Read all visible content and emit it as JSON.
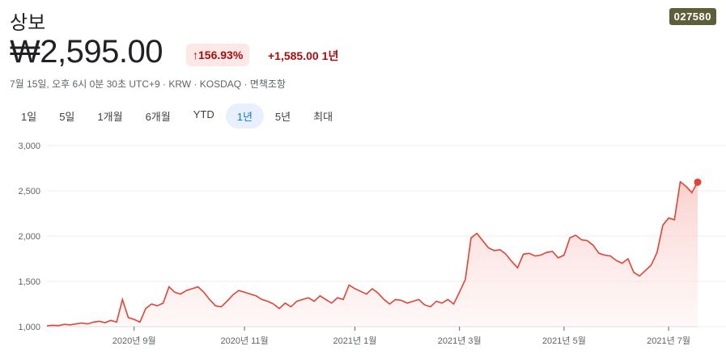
{
  "header": {
    "title": "상보",
    "ticker": "027580",
    "price": "₩2,595.00",
    "pct_change": "↑156.93%",
    "abs_change": "+1,585.00",
    "change_period": "1년",
    "meta": "7월 15일, 오후 6시 0분 30초 UTC+9 · KRW · KOSDAQ · 면책조항"
  },
  "ranges": [
    "1일",
    "5일",
    "1개월",
    "6개월",
    "YTD",
    "1년",
    "5년",
    "최대"
  ],
  "active_range": "1년",
  "colors": {
    "line": "#e34234",
    "fill_top": "#f8c9c4",
    "accent_bg": "#e8f0fe",
    "accent": "#1a73e8"
  },
  "chart_data": {
    "type": "area",
    "ylim": [
      1000,
      3000
    ],
    "yticks": [
      1000,
      1500,
      2000,
      2500,
      3000
    ],
    "ytick_labels": [
      "1,000",
      "1,500",
      "2,000",
      "2,500",
      "3,000"
    ],
    "xticks": [
      {
        "x": 15,
        "label": "2020년 9월"
      },
      {
        "x": 34,
        "label": "2020년 11월"
      },
      {
        "x": 53,
        "label": "2021년 1월"
      },
      {
        "x": 71,
        "label": "2021년 3월"
      },
      {
        "x": 89,
        "label": "2021년 5월"
      },
      {
        "x": 107,
        "label": "2021년 7월"
      }
    ],
    "x_range": [
      0,
      112
    ],
    "values": [
      1010,
      1015,
      1012,
      1025,
      1020,
      1030,
      1040,
      1030,
      1050,
      1060,
      1045,
      1070,
      1050,
      1300,
      1100,
      1080,
      1050,
      1200,
      1250,
      1230,
      1260,
      1440,
      1380,
      1360,
      1400,
      1420,
      1440,
      1380,
      1300,
      1230,
      1220,
      1280,
      1350,
      1400,
      1380,
      1360,
      1340,
      1300,
      1280,
      1250,
      1200,
      1260,
      1220,
      1280,
      1300,
      1320,
      1280,
      1340,
      1300,
      1260,
      1320,
      1300,
      1460,
      1420,
      1390,
      1360,
      1420,
      1370,
      1300,
      1250,
      1300,
      1290,
      1260,
      1280,
      1300,
      1240,
      1220,
      1280,
      1260,
      1300,
      1250,
      1380,
      1520,
      1980,
      2030,
      1950,
      1870,
      1840,
      1850,
      1800,
      1720,
      1650,
      1800,
      1810,
      1780,
      1790,
      1820,
      1830,
      1760,
      1790,
      1980,
      2010,
      1960,
      1950,
      1900,
      1810,
      1790,
      1780,
      1730,
      1700,
      1750,
      1600,
      1560,
      1620,
      1680,
      1820,
      2120,
      2200,
      2180,
      2600,
      2550,
      2480,
      2600
    ],
    "last_point": 2595
  }
}
